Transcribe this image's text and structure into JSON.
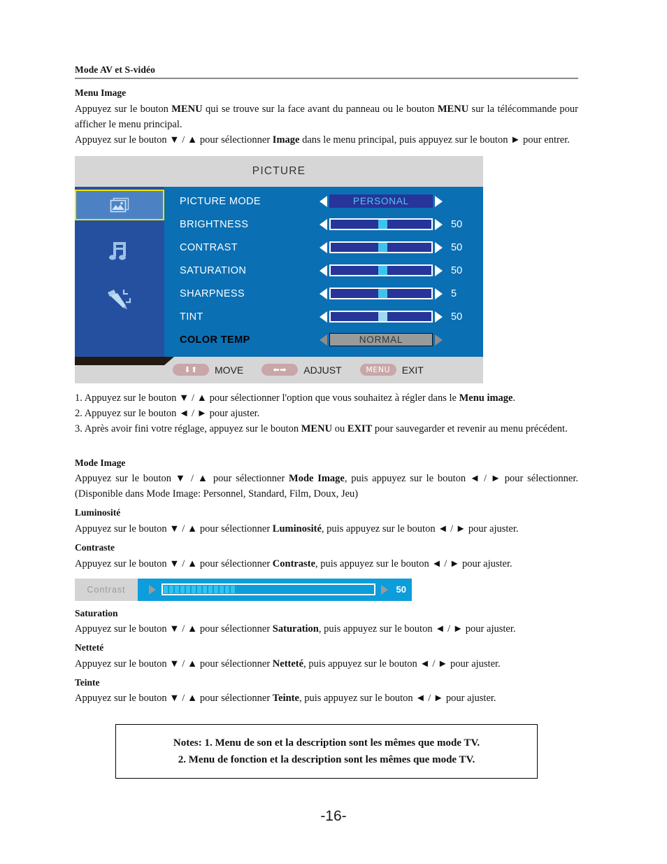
{
  "running_head": "Mode AV et S-vidéo",
  "sections": {
    "menu_image_heading": "Menu Image",
    "intro_p1_a": "Appuyez sur le bouton ",
    "intro_p1_menu1": "MENU",
    "intro_p1_b": " qui se trouve sur la face avant du panneau ou le bouton ",
    "intro_p1_menu2": "MENU",
    "intro_p1_c": " sur la télécommande pour afficher le menu principal.",
    "intro_p2_a": "Appuyez sur le bouton ▼ / ▲ pour sélectionner ",
    "intro_p2_img": "Image",
    "intro_p2_b": " dans le menu principal, puis appuyez sur le bouton ► pour entrer."
  },
  "osd": {
    "title": "PICTURE",
    "sidebar": [
      {
        "name": "picture-icon",
        "selected": true
      },
      {
        "name": "sound-note-icon",
        "selected": false
      },
      {
        "name": "function-pen-icon",
        "selected": false
      }
    ],
    "rows": [
      {
        "label": "PICTURE MODE",
        "type": "option",
        "value": "PERSONAL",
        "number": "",
        "thumb_pct": 0,
        "style": "normal"
      },
      {
        "label": "BRIGHTNESS",
        "type": "slider",
        "value": "",
        "number": "50",
        "thumb_pct": 47,
        "style": "normal"
      },
      {
        "label": "CONTRAST",
        "type": "slider",
        "value": "",
        "number": "50",
        "thumb_pct": 47,
        "style": "normal"
      },
      {
        "label": "SATURATION",
        "type": "slider",
        "value": "",
        "number": "50",
        "thumb_pct": 47,
        "style": "normal"
      },
      {
        "label": "SHARPNESS",
        "type": "slider",
        "value": "",
        "number": "5",
        "thumb_pct": 47,
        "style": "normal"
      },
      {
        "label": "TINT",
        "type": "slider",
        "value": "",
        "number": "50",
        "thumb_pct": 47,
        "style": "lite"
      },
      {
        "label": "COLOR TEMP",
        "type": "option",
        "value": "NORMAL",
        "number": "",
        "thumb_pct": 0,
        "style": "dim"
      }
    ],
    "footer": [
      {
        "glyph": "⬇⬆",
        "label": "MOVE",
        "icon": "up-down-arrows-icon"
      },
      {
        "glyph": "⬅➡",
        "label": "ADJUST",
        "icon": "left-right-arrows-icon"
      },
      {
        "glyph": "MENU",
        "label": "EXIT",
        "icon": "menu-key-icon"
      }
    ]
  },
  "steps": {
    "s1_a": "1. Appuyez sur le bouton ▼ / ▲ pour sélectionner l'option que vous souhaitez à régler dans le ",
    "s1_b": "Menu image",
    "s1_c": ".",
    "s2": "2. Appuyez sur le bouton ◄ / ► pour ajuster.",
    "s3_a": "3. Après avoir fini votre réglage, appuyez sur le bouton ",
    "s3_menu": "MENU",
    "s3_b": " ou ",
    "s3_exit": "EXIT",
    "s3_c": " pour sauvegarder et revenir au menu précédent."
  },
  "details": {
    "mode_image_heading": "Mode Image",
    "mode_image_a": "Appuyez sur le bouton ▼ / ▲ pour sélectionner ",
    "mode_image_b": "Mode Image",
    "mode_image_c": ", puis appuyez sur le bouton ◄ / ► pour sélectionner. (Disponible dans Mode Image: Personnel, Standard, Film, Doux, Jeu)",
    "luminosite_heading": "Luminosité",
    "luminosite_a": "Appuyez sur le bouton ▼ / ▲ pour sélectionner ",
    "luminosite_b": "Luminosité",
    "luminosite_c": ", puis appuyez sur le bouton ◄ / ► pour ajuster.",
    "contraste_heading": "Contraste",
    "contraste_a": "Appuyez sur le bouton ▼ / ▲ pour sélectionner ",
    "contraste_b": "Contraste",
    "contraste_c": ", puis appuyez sur le bouton ◄ / ► pour ajuster.",
    "saturation_heading": "Saturation",
    "saturation_a": "Appuyez sur le bouton ▼ / ▲ pour sélectionner ",
    "saturation_b": "Saturation",
    "saturation_c": ", puis appuyez sur le bouton ◄ / ► pour ajuster.",
    "nettete_heading": "Netteté",
    "nettete_a": "Appuyez sur le bouton ▼ / ▲ pour sélectionner ",
    "nettete_b": "Netteté",
    "nettete_c": ", puis appuyez sur le bouton ◄ / ► pour ajuster.",
    "teinte_heading": "Teinte",
    "teinte_a": "Appuyez sur le bouton ▼ / ▲ pour sélectionner ",
    "teinte_b": "Teinte",
    "teinte_c": ", puis appuyez sur le bouton ◄ / ► pour ajuster."
  },
  "contrast_widget": {
    "label": "Contrast",
    "value": "50",
    "segments": 13
  },
  "notes": {
    "line1": "Notes: 1. Menu de son et la description sont les mêmes que mode TV.",
    "line2": "2. Menu de fonction et la description sont les mêmes que mode TV."
  },
  "page_number": "-16-",
  "colors": {
    "osd_header_bg": "#d6d6d6",
    "osd_main_bg": "#0b6fb4",
    "osd_sidebar_bg": "#2550a0",
    "selected_border": "#f2e300",
    "slider_track": "#27349a",
    "slider_thumb": "#3fc3ec",
    "option_text": "#53c8ee",
    "footer_pill": "#c9a6a8",
    "contrast_widget_bg": "#0d9ddb",
    "contrast_seg": "#2ec4f0"
  }
}
